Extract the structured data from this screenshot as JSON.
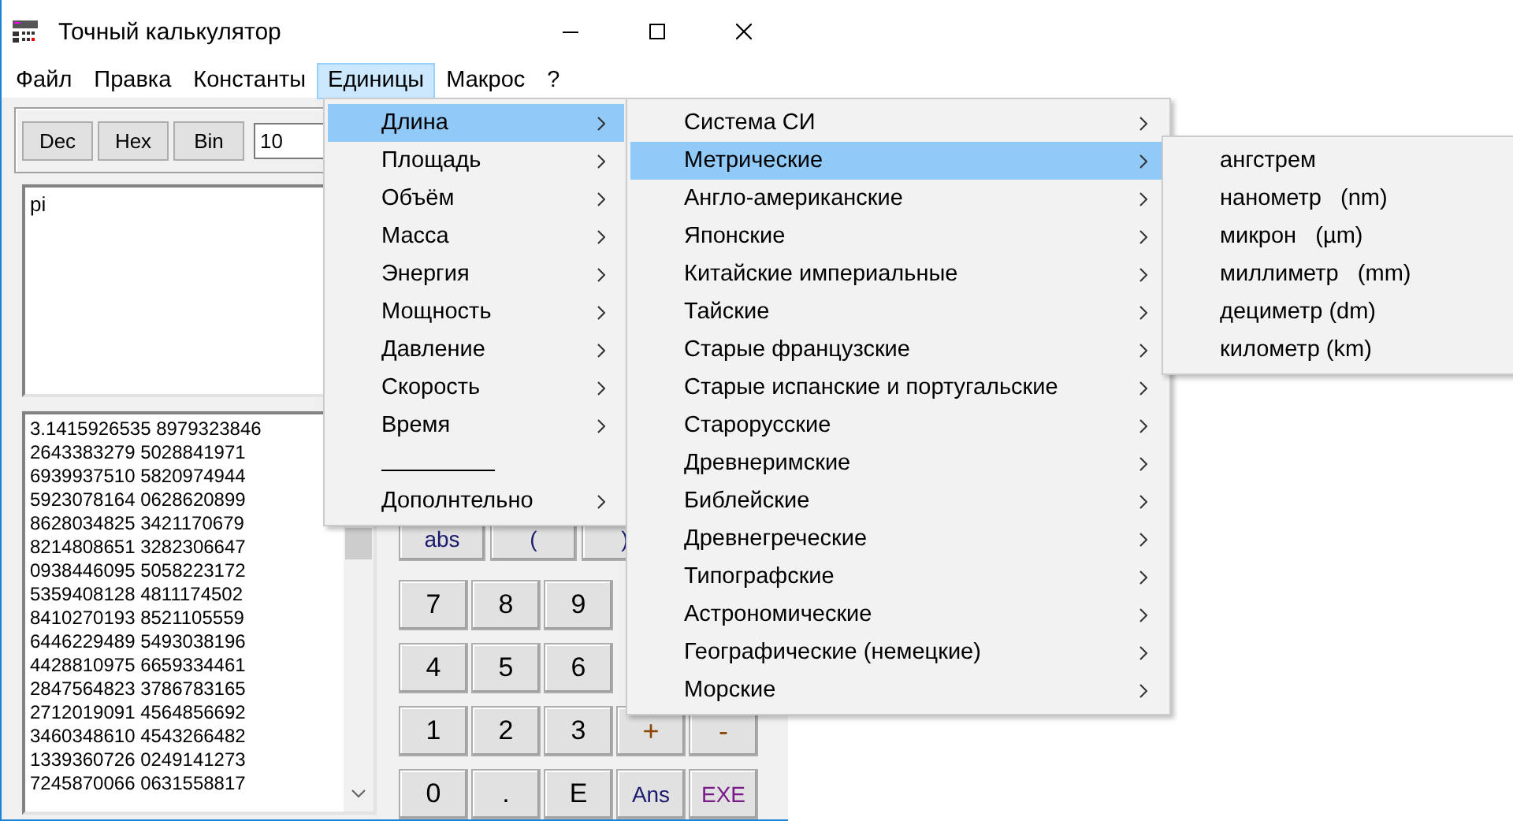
{
  "window": {
    "title": "Точный калькулятор"
  },
  "menu_bar": [
    {
      "label": "Файл",
      "selected": false
    },
    {
      "label": "Правка",
      "selected": false
    },
    {
      "label": "Константы",
      "selected": false
    },
    {
      "label": "Единицы",
      "selected": true
    },
    {
      "label": "Макрос",
      "selected": false
    },
    {
      "label": "?",
      "selected": false
    }
  ],
  "base_buttons": [
    "Dec",
    "Hex",
    "Bin"
  ],
  "base_field": {
    "value": "10"
  },
  "expression": {
    "value": "pi"
  },
  "results": [
    "3.1415926535 8979323846",
    "2643383279 5028841971",
    "6939937510 5820974944",
    "5923078164 0628620899",
    "8628034825 3421170679",
    "8214808651 3282306647",
    "0938446095 5058223172",
    "5359408128 4811174502",
    "8410270193 8521105559",
    "6446229489 5493038196",
    "4428810975 6659334461",
    "2847564823 3786783165",
    "2712019091 4564856692",
    "3460348610 4543266482",
    "1339360726 0249141273",
    "7245870066 0631558817"
  ],
  "keypad": [
    [
      {
        "label": "abs",
        "kind": "function"
      },
      {
        "label": "(",
        "kind": "function"
      },
      {
        "label": ")",
        "kind": "function"
      }
    ],
    [
      {
        "label": "7",
        "kind": "digit"
      },
      {
        "label": "8",
        "kind": "digit"
      },
      {
        "label": "9",
        "kind": "digit"
      }
    ],
    [
      {
        "label": "4",
        "kind": "digit"
      },
      {
        "label": "5",
        "kind": "digit"
      },
      {
        "label": "6",
        "kind": "digit"
      }
    ],
    [
      {
        "label": "1",
        "kind": "digit"
      },
      {
        "label": "2",
        "kind": "digit"
      },
      {
        "label": "3",
        "kind": "digit"
      },
      {
        "label": "+",
        "kind": "operator"
      },
      {
        "label": "-",
        "kind": "operator"
      }
    ],
    [
      {
        "label": "0",
        "kind": "digit"
      },
      {
        "label": ".",
        "kind": "digit"
      },
      {
        "label": "E",
        "kind": "digit"
      },
      {
        "label": "Ans",
        "kind": "function"
      },
      {
        "label": "EXE",
        "kind": "execute"
      }
    ]
  ],
  "units_menu": [
    {
      "kind": "item",
      "label": "Длина",
      "selected": true,
      "submenu": true
    },
    {
      "kind": "item",
      "label": "Площадь",
      "selected": false,
      "submenu": true
    },
    {
      "kind": "item",
      "label": "Объём",
      "selected": false,
      "submenu": true
    },
    {
      "kind": "item",
      "label": "Масса",
      "selected": false,
      "submenu": true
    },
    {
      "kind": "item",
      "label": "Энергия",
      "selected": false,
      "submenu": true
    },
    {
      "kind": "item",
      "label": "Мощность",
      "selected": false,
      "submenu": true
    },
    {
      "kind": "item",
      "label": "Давление",
      "selected": false,
      "submenu": true
    },
    {
      "kind": "item",
      "label": "Скорость",
      "selected": false,
      "submenu": true
    },
    {
      "kind": "item",
      "label": "Время",
      "selected": false,
      "submenu": true
    },
    {
      "kind": "separator"
    },
    {
      "kind": "item",
      "label": "Дополнтельно",
      "selected": false,
      "submenu": true
    }
  ],
  "length_menu": [
    {
      "kind": "item",
      "label": "Система СИ",
      "selected": false,
      "submenu": true
    },
    {
      "kind": "item",
      "label": "Метрические",
      "selected": true,
      "submenu": true
    },
    {
      "kind": "item",
      "label": "Англо-американские",
      "selected": false,
      "submenu": true
    },
    {
      "kind": "item",
      "label": "Японские",
      "selected": false,
      "submenu": true
    },
    {
      "kind": "item",
      "label": "Китайские империальные",
      "selected": false,
      "submenu": true
    },
    {
      "kind": "item",
      "label": "Тайские",
      "selected": false,
      "submenu": true
    },
    {
      "kind": "item",
      "label": "Старые французские",
      "selected": false,
      "submenu": true
    },
    {
      "kind": "item",
      "label": "Старые испанские и португальские",
      "selected": false,
      "submenu": true
    },
    {
      "kind": "item",
      "label": "Старорусские",
      "selected": false,
      "submenu": true
    },
    {
      "kind": "item",
      "label": "Древнеримские",
      "selected": false,
      "submenu": true
    },
    {
      "kind": "item",
      "label": "Библейские",
      "selected": false,
      "submenu": true
    },
    {
      "kind": "item",
      "label": "Древнегреческие",
      "selected": false,
      "submenu": true
    },
    {
      "kind": "item",
      "label": "Типографские",
      "selected": false,
      "submenu": true
    },
    {
      "kind": "item",
      "label": "Астрономические",
      "selected": false,
      "submenu": true
    },
    {
      "kind": "item",
      "label": "Географические (немецкие)",
      "selected": false,
      "submenu": true
    },
    {
      "kind": "item",
      "label": "Морские",
      "selected": false,
      "submenu": true
    }
  ],
  "metric_menu": [
    {
      "kind": "item",
      "label": "ангстрем",
      "selected": false,
      "submenu": false
    },
    {
      "kind": "item",
      "label": "нанометр   (nm)",
      "selected": false,
      "submenu": false
    },
    {
      "kind": "item",
      "label": "микрон   (µm)",
      "selected": false,
      "submenu": false
    },
    {
      "kind": "item",
      "label": "миллиметр   (mm)",
      "selected": false,
      "submenu": false
    },
    {
      "kind": "item",
      "label": "дециметр (dm)",
      "selected": false,
      "submenu": false
    },
    {
      "kind": "item",
      "label": "километр (km)",
      "selected": false,
      "submenu": false
    }
  ]
}
